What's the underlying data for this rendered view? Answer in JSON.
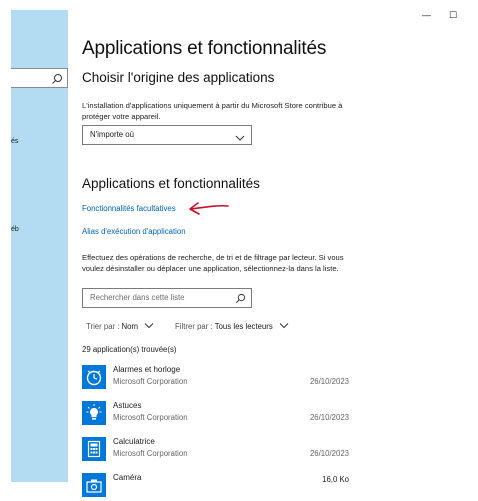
{
  "window": {
    "minimize_glyph": "—",
    "maximize_glyph": "☐"
  },
  "sidebar": {
    "fragments": [
      "és",
      "éb"
    ]
  },
  "page": {
    "title": "Applications et fonctionnalités"
  },
  "install_source": {
    "heading": "Choisir l'origine des applications",
    "description": "L'installation d'applications uniquement à partir du Microsoft Store contribue à protéger votre appareil.",
    "dropdown_value": "N'importe où"
  },
  "apps_section": {
    "heading": "Applications et fonctionnalités",
    "optional_features_link": "Fonctionnalités facultatives",
    "alias_link": "Alias d'exécution d'application",
    "description": "Effectuez des opérations de recherche, de tri et de filtrage par lecteur. Si vous voulez désinstaller ou déplacer une application, sélectionnez-la dans la liste.",
    "search_placeholder": "Rechercher dans cette liste",
    "sort_label": "Trier par :",
    "sort_value": "Nom",
    "filter_label": "Filtrer par :",
    "filter_value": "Tous les lecteurs",
    "count_text": "29 application(s) trouvée(s)"
  },
  "apps": [
    {
      "name": "Alarmes et horloge",
      "publisher": "Microsoft Corporation",
      "date": "26/10/2023",
      "icon": "alarm-clock-icon"
    },
    {
      "name": "Astuces",
      "publisher": "Microsoft Corporation",
      "date": "26/10/2023",
      "icon": "lightbulb-icon"
    },
    {
      "name": "Calculatrice",
      "publisher": "Microsoft Corporation",
      "date": "26/10/2023",
      "icon": "calculator-icon"
    },
    {
      "name": "Caméra",
      "size": "16,0 Ko",
      "icon": "camera-icon"
    }
  ],
  "colors": {
    "accent": "#0078d7",
    "link": "#0063b1",
    "sidebar": "#b3dcf3",
    "annotation_arrow": "#c8102e"
  }
}
